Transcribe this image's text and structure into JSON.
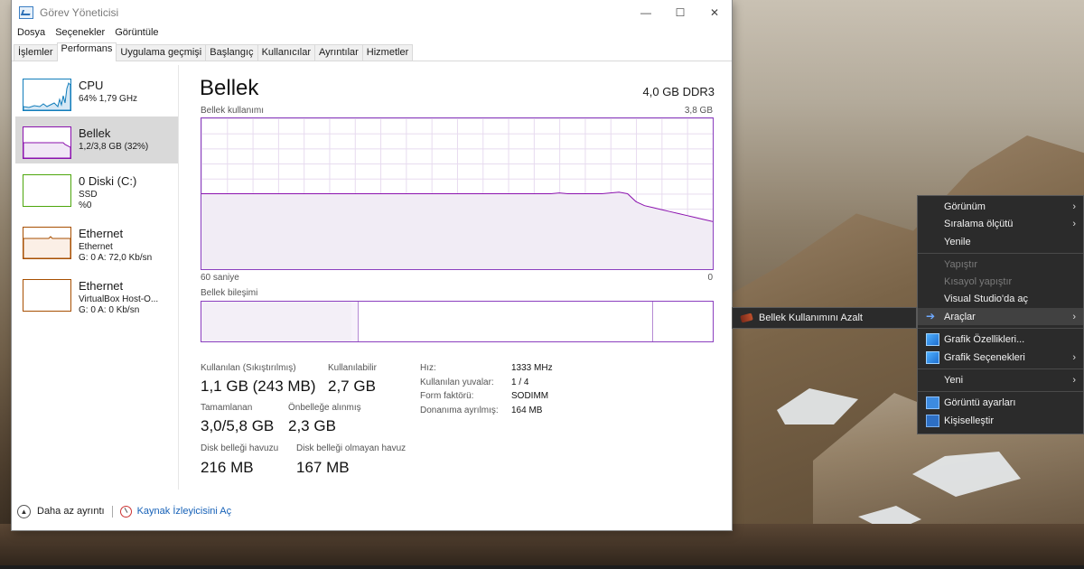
{
  "window": {
    "title": "Görev Yöneticisi",
    "controls": {
      "minimize": "—",
      "maximize": "☐",
      "close": "✕"
    }
  },
  "menu": [
    "Dosya",
    "Seçenekler",
    "Görüntüle"
  ],
  "tabs": [
    "İşlemler",
    "Performans",
    "Uygulama geçmişi",
    "Başlangıç",
    "Kullanıcılar",
    "Ayrıntılar",
    "Hizmetler"
  ],
  "active_tab": "Performans",
  "left_panel": {
    "items": [
      {
        "name": "CPU",
        "sub1": "64%  1,79 GHz",
        "sub2": "",
        "color": "#117dbb"
      },
      {
        "name": "Bellek",
        "sub1": "1,2/3,8 GB (32%)",
        "sub2": "",
        "color": "#8b12ae"
      },
      {
        "name": "0 Diski (C:)",
        "sub1": "SSD",
        "sub2": "%0",
        "color": "#4da60c"
      },
      {
        "name": "Ethernet",
        "sub1": "Ethernet",
        "sub2": "G: 0 A: 72,0 Kb/sn",
        "color": "#a74f01"
      },
      {
        "name": "Ethernet",
        "sub1": "VirtualBox Host-O...",
        "sub2": "G: 0 A: 0 Kb/sn",
        "color": "#a74f01"
      }
    ]
  },
  "main": {
    "title": "Bellek",
    "mem_type": "4,0 GB DDR3",
    "usage_label": "Bellek kullanımı",
    "usage_max": "3,8 GB",
    "x_left": "60 saniye",
    "x_right": "0",
    "composition_label": "Bellek bileşimi",
    "stats": {
      "in_use_label": "Kullanılan (Sıkıştırılmış)",
      "in_use_value": "1,1 GB (243 MB)",
      "available_label": "Kullanılabilir",
      "available_value": "2,7 GB",
      "committed_label": "Tamamlanan",
      "committed_value": "3,0/5,8 GB",
      "cached_label": "Önbelleğe alınmış",
      "cached_value": "2,3 GB",
      "paged_label": "Disk belleği havuzu",
      "paged_value": "216 MB",
      "nonpaged_label": "Disk belleği olmayan havuz",
      "nonpaged_value": "167 MB"
    },
    "specs": [
      {
        "label": "Hız:",
        "value": "1333 MHz"
      },
      {
        "label": "Kullanılan yuvalar:",
        "value": "1 / 4"
      },
      {
        "label": "Form faktörü:",
        "value": "SODIMM"
      },
      {
        "label": "Donanıma ayrılmış:",
        "value": "164 MB"
      }
    ]
  },
  "footer": {
    "fewer_details": "Daha az ayrıntı",
    "resource_monitor": "Kaynak İzleyicisini Aç"
  },
  "context_menu": {
    "items": [
      {
        "label": "Görünüm",
        "submenu": true,
        "disabled": false,
        "icon": ""
      },
      {
        "label": "Sıralama ölçütü",
        "submenu": true,
        "disabled": false,
        "icon": ""
      },
      {
        "label": "Yenile",
        "submenu": false,
        "disabled": false,
        "icon": ""
      },
      {
        "label": "Yapıştır",
        "submenu": false,
        "disabled": true,
        "icon": ""
      },
      {
        "label": "Kısayol yapıştır",
        "submenu": false,
        "disabled": true,
        "icon": ""
      },
      {
        "label": "Visual Studio'da aç",
        "submenu": false,
        "disabled": false,
        "icon": ""
      },
      {
        "label": "Araçlar",
        "submenu": true,
        "disabled": false,
        "icon": "arrow-icon"
      },
      {
        "label": "Grafik Özellikleri...",
        "submenu": false,
        "disabled": false,
        "icon": "graphics-icon"
      },
      {
        "label": "Grafik Seçenekleri",
        "submenu": true,
        "disabled": false,
        "icon": "graphics-icon"
      },
      {
        "label": "Yeni",
        "submenu": true,
        "disabled": false,
        "icon": ""
      },
      {
        "label": "Görüntü ayarları",
        "submenu": false,
        "disabled": false,
        "icon": "display-icon"
      },
      {
        "label": "Kişiselleştir",
        "submenu": false,
        "disabled": false,
        "icon": "personalize-icon"
      }
    ],
    "submenu_item": "Bellek Kullanımını Azalt"
  },
  "memory_graph": {
    "max_gb": 3.8,
    "seconds": 60,
    "usage_gb": [
      1.9,
      1.9,
      1.9,
      1.9,
      1.9,
      1.9,
      1.9,
      1.9,
      1.9,
      1.9,
      1.9,
      1.9,
      1.9,
      1.9,
      1.9,
      1.9,
      1.9,
      1.9,
      1.9,
      1.9,
      1.9,
      1.9,
      1.9,
      1.9,
      1.9,
      1.9,
      1.9,
      1.9,
      1.9,
      1.9,
      1.9,
      1.9,
      1.9,
      1.9,
      1.9,
      1.9,
      1.9,
      1.9,
      1.9,
      1.9,
      1.9,
      1.9,
      1.92,
      1.9,
      1.9,
      1.9,
      1.9,
      1.9,
      1.92,
      1.94,
      1.9,
      1.7,
      1.6,
      1.55,
      1.5,
      1.45,
      1.4,
      1.35,
      1.3,
      1.25,
      1.2
    ]
  }
}
